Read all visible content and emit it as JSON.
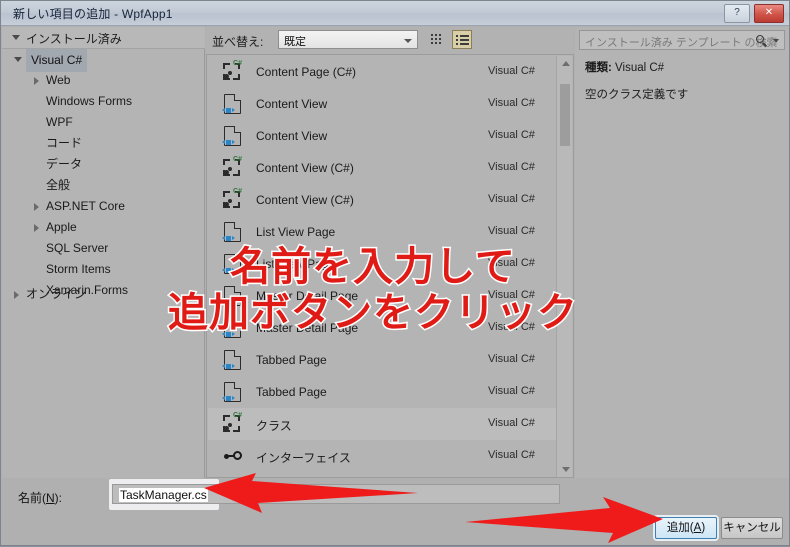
{
  "window": {
    "title": "新しい項目の追加 - WpfApp1",
    "help_label": "?",
    "close_label": "✕"
  },
  "sidebar": {
    "header": "インストール済み",
    "root": "Visual C#",
    "items": [
      {
        "label": "Web",
        "level": 2,
        "expandable": true
      },
      {
        "label": "Windows Forms",
        "level": 2,
        "expandable": false
      },
      {
        "label": "WPF",
        "level": 2,
        "expandable": false
      },
      {
        "label": "コード",
        "level": 2,
        "expandable": false
      },
      {
        "label": "データ",
        "level": 2,
        "expandable": false
      },
      {
        "label": "全般",
        "level": 2,
        "expandable": false
      },
      {
        "label": "ASP.NET Core",
        "level": 2,
        "expandable": true
      },
      {
        "label": "Apple",
        "level": 2,
        "expandable": true
      },
      {
        "label": "SQL Server",
        "level": 2,
        "expandable": false
      },
      {
        "label": "Storm Items",
        "level": 2,
        "expandable": false
      },
      {
        "label": "Xamarin.Forms",
        "level": 2,
        "expandable": false
      }
    ],
    "online": "オンライン"
  },
  "toolbar": {
    "sort_label": "並べ替え:",
    "sort_value": "既定",
    "grid_view_icon": "grid-view-icon",
    "list_view_icon": "list-view-icon"
  },
  "template_list": {
    "rows": [
      {
        "name": "Content Page (C#)",
        "lang": "Visual C#",
        "icon": "csharp-class-icon",
        "selected": false
      },
      {
        "name": "Content View",
        "lang": "Visual C#",
        "icon": "xaml-page-icon",
        "selected": false
      },
      {
        "name": "Content View",
        "lang": "Visual C#",
        "icon": "xaml-page-icon",
        "selected": false
      },
      {
        "name": "Content View (C#)",
        "lang": "Visual C#",
        "icon": "csharp-class-icon",
        "selected": false
      },
      {
        "name": "Content View (C#)",
        "lang": "Visual C#",
        "icon": "csharp-class-icon",
        "selected": false
      },
      {
        "name": "List View Page",
        "lang": "Visual C#",
        "icon": "xaml-page-icon",
        "selected": false
      },
      {
        "name": "List View Page",
        "lang": "Visual C#",
        "icon": "xaml-page-icon",
        "selected": false
      },
      {
        "name": "Master Detail Page",
        "lang": "Visual C#",
        "icon": "xaml-page-icon",
        "selected": false
      },
      {
        "name": "Master Detail Page",
        "lang": "Visual C#",
        "icon": "xaml-page-icon",
        "selected": false
      },
      {
        "name": "Tabbed Page",
        "lang": "Visual C#",
        "icon": "xaml-page-icon",
        "selected": false
      },
      {
        "name": "Tabbed Page",
        "lang": "Visual C#",
        "icon": "xaml-page-icon",
        "selected": false
      },
      {
        "name": "クラス",
        "lang": "Visual C#",
        "icon": "csharp-class-icon",
        "selected": true
      },
      {
        "name": "インターフェイス",
        "lang": "Visual C#",
        "icon": "interface-icon",
        "selected": false
      }
    ]
  },
  "search": {
    "placeholder": "インストール済み テンプレート の検索",
    "icon": "search-icon"
  },
  "details": {
    "kind_label": "種類:",
    "kind_value": "Visual C#",
    "description": "空のクラス定義です"
  },
  "footer": {
    "name_label_pre": "名前(",
    "name_label_key": "N",
    "name_label_post": "):",
    "name_value": "TaskManager.cs",
    "add_pre": "追加(",
    "add_key": "A",
    "add_post": ")",
    "cancel_label": "キャンセル"
  },
  "annotation": {
    "line1": "名前を入力して",
    "line2": "追加ボタンをクリック",
    "color": "#e01b16"
  }
}
